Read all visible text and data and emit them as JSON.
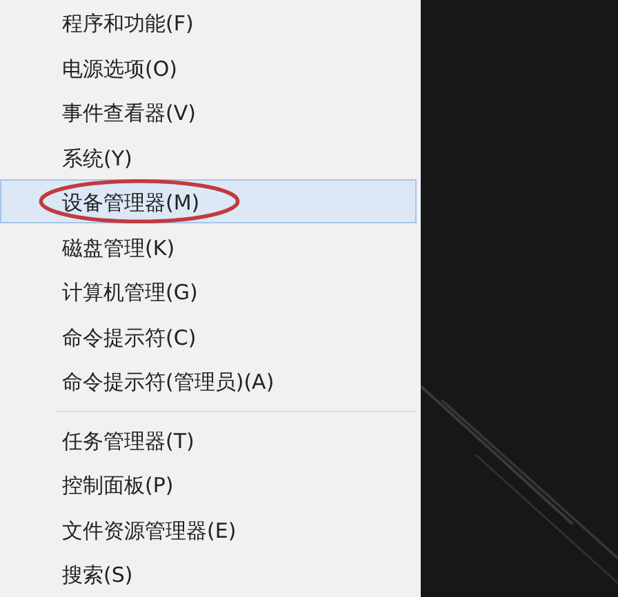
{
  "menu": {
    "sections": [
      {
        "items": [
          {
            "label": "程序和功能(F)",
            "selected": false,
            "circled": false
          },
          {
            "label": "电源选项(O)",
            "selected": false,
            "circled": false
          },
          {
            "label": "事件查看器(V)",
            "selected": false,
            "circled": false
          },
          {
            "label": "系统(Y)",
            "selected": false,
            "circled": false
          },
          {
            "label": "设备管理器(M)",
            "selected": true,
            "circled": true
          },
          {
            "label": "磁盘管理(K)",
            "selected": false,
            "circled": false
          },
          {
            "label": "计算机管理(G)",
            "selected": false,
            "circled": false
          },
          {
            "label": "命令提示符(C)",
            "selected": false,
            "circled": false
          },
          {
            "label": "命令提示符(管理员)(A)",
            "selected": false,
            "circled": false
          }
        ]
      },
      {
        "items": [
          {
            "label": "任务管理器(T)",
            "selected": false,
            "circled": false
          },
          {
            "label": "控制面板(P)",
            "selected": false,
            "circled": false
          },
          {
            "label": "文件资源管理器(E)",
            "selected": false,
            "circled": false
          },
          {
            "label": "搜索(S)",
            "selected": false,
            "circled": false
          }
        ]
      }
    ]
  }
}
